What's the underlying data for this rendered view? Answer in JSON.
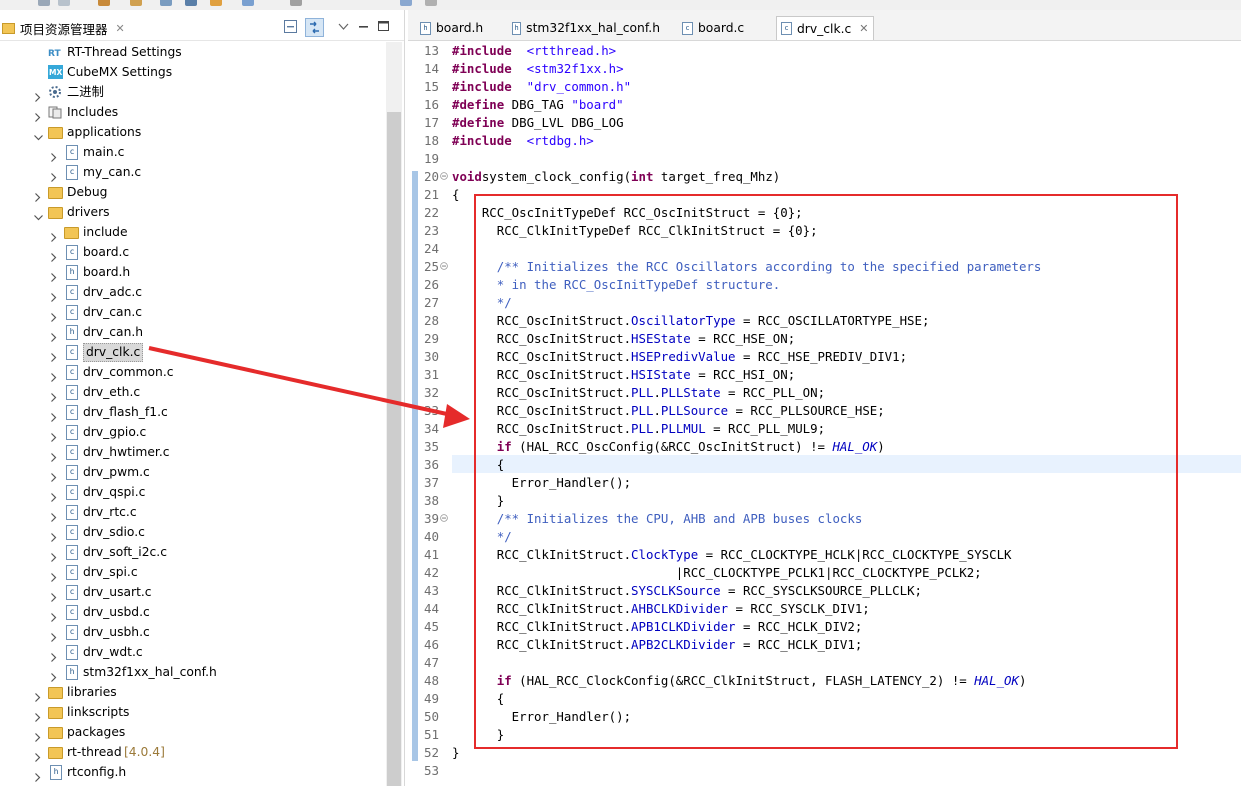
{
  "explorer": {
    "title": "项目资源管理器",
    "close": "✕",
    "items": [
      {
        "label": "RT-Thread Settings",
        "icon": "rt-thread-settings-icon",
        "depth": 1,
        "twisty": "",
        "kind": "special"
      },
      {
        "label": "CubeMX Settings",
        "icon": "cubemx-icon",
        "depth": 1,
        "twisty": "",
        "kind": "special"
      },
      {
        "label": "二进制",
        "icon": "binaries-icon",
        "depth": 1,
        "twisty": ">",
        "kind": "special"
      },
      {
        "label": "Includes",
        "icon": "includes-icon",
        "depth": 1,
        "twisty": ">",
        "kind": "special"
      },
      {
        "label": "applications",
        "icon": "folder-icon",
        "depth": 1,
        "twisty": "v",
        "kind": "folder"
      },
      {
        "label": "main.c",
        "icon": "c-file-icon",
        "depth": 2,
        "twisty": ">",
        "kind": "c"
      },
      {
        "label": "my_can.c",
        "icon": "c-file-icon",
        "depth": 2,
        "twisty": ">",
        "kind": "c"
      },
      {
        "label": "Debug",
        "icon": "folder-icon",
        "depth": 1,
        "twisty": ">",
        "kind": "folder"
      },
      {
        "label": "drivers",
        "icon": "folder-icon",
        "depth": 1,
        "twisty": "v",
        "kind": "folder"
      },
      {
        "label": "include",
        "icon": "folder-icon",
        "depth": 2,
        "twisty": ">",
        "kind": "folder"
      },
      {
        "label": "board.c",
        "icon": "c-file-icon",
        "depth": 2,
        "twisty": ">",
        "kind": "c"
      },
      {
        "label": "board.h",
        "icon": "h-file-icon",
        "depth": 2,
        "twisty": ">",
        "kind": "h"
      },
      {
        "label": "drv_adc.c",
        "icon": "c-file-icon",
        "depth": 2,
        "twisty": ">",
        "kind": "c"
      },
      {
        "label": "drv_can.c",
        "icon": "c-file-icon",
        "depth": 2,
        "twisty": ">",
        "kind": "c"
      },
      {
        "label": "drv_can.h",
        "icon": "h-file-icon",
        "depth": 2,
        "twisty": ">",
        "kind": "h"
      },
      {
        "label": "drv_clk.c",
        "icon": "c-file-icon",
        "depth": 2,
        "twisty": ">",
        "kind": "c",
        "selected": true
      },
      {
        "label": "drv_common.c",
        "icon": "c-file-icon",
        "depth": 2,
        "twisty": ">",
        "kind": "c"
      },
      {
        "label": "drv_eth.c",
        "icon": "c-file-icon",
        "depth": 2,
        "twisty": ">",
        "kind": "c"
      },
      {
        "label": "drv_flash_f1.c",
        "icon": "c-file-icon",
        "depth": 2,
        "twisty": ">",
        "kind": "c"
      },
      {
        "label": "drv_gpio.c",
        "icon": "c-file-icon",
        "depth": 2,
        "twisty": ">",
        "kind": "c"
      },
      {
        "label": "drv_hwtimer.c",
        "icon": "c-file-icon",
        "depth": 2,
        "twisty": ">",
        "kind": "c"
      },
      {
        "label": "drv_pwm.c",
        "icon": "c-file-icon",
        "depth": 2,
        "twisty": ">",
        "kind": "c"
      },
      {
        "label": "drv_qspi.c",
        "icon": "c-file-icon",
        "depth": 2,
        "twisty": ">",
        "kind": "c"
      },
      {
        "label": "drv_rtc.c",
        "icon": "c-file-icon",
        "depth": 2,
        "twisty": ">",
        "kind": "c"
      },
      {
        "label": "drv_sdio.c",
        "icon": "c-file-icon",
        "depth": 2,
        "twisty": ">",
        "kind": "c"
      },
      {
        "label": "drv_soft_i2c.c",
        "icon": "c-file-icon",
        "depth": 2,
        "twisty": ">",
        "kind": "c"
      },
      {
        "label": "drv_spi.c",
        "icon": "c-file-icon",
        "depth": 2,
        "twisty": ">",
        "kind": "c"
      },
      {
        "label": "drv_usart.c",
        "icon": "c-file-icon",
        "depth": 2,
        "twisty": ">",
        "kind": "c"
      },
      {
        "label": "drv_usbd.c",
        "icon": "c-file-icon",
        "depth": 2,
        "twisty": ">",
        "kind": "c"
      },
      {
        "label": "drv_usbh.c",
        "icon": "c-file-icon",
        "depth": 2,
        "twisty": ">",
        "kind": "c"
      },
      {
        "label": "drv_wdt.c",
        "icon": "c-file-icon",
        "depth": 2,
        "twisty": ">",
        "kind": "c"
      },
      {
        "label": "stm32f1xx_hal_conf.h",
        "icon": "h-file-icon",
        "depth": 2,
        "twisty": ">",
        "kind": "h"
      },
      {
        "label": "libraries",
        "icon": "folder-icon",
        "depth": 1,
        "twisty": ">",
        "kind": "folder"
      },
      {
        "label": "linkscripts",
        "icon": "folder-icon",
        "depth": 1,
        "twisty": ">",
        "kind": "folder"
      },
      {
        "label": "packages",
        "icon": "folder-icon",
        "depth": 1,
        "twisty": ">",
        "kind": "folder"
      },
      {
        "label": "rt-thread",
        "icon": "folder-icon",
        "depth": 1,
        "twisty": ">",
        "kind": "folder",
        "suffix": "[4.0.4]"
      },
      {
        "label": "rtconfig.h",
        "icon": "h-file-icon",
        "depth": 1,
        "twisty": ">",
        "kind": "h"
      }
    ]
  },
  "editor_tabs": [
    {
      "label": "board.h",
      "icon": "h-file-icon",
      "active": false
    },
    {
      "label": "stm32f1xx_hal_conf.h",
      "icon": "h-file-icon",
      "active": false
    },
    {
      "label": "board.c",
      "icon": "c-file-icon",
      "active": false
    },
    {
      "label": "drv_clk.c",
      "icon": "c-file-icon",
      "active": true,
      "close": "✕"
    }
  ],
  "code_lines": [
    {
      "n": "13",
      "tokens": [
        [
          "kw",
          "#include"
        ],
        [
          "",
          "  "
        ],
        [
          "str",
          "<rtthread.h>"
        ]
      ]
    },
    {
      "n": "14",
      "tokens": [
        [
          "kw",
          "#include"
        ],
        [
          "",
          "  "
        ],
        [
          "str",
          "<stm32f1xx.h>"
        ]
      ]
    },
    {
      "n": "15",
      "tokens": [
        [
          "kw",
          "#include"
        ],
        [
          "",
          "  "
        ],
        [
          "str",
          "\"drv_common.h\""
        ]
      ]
    },
    {
      "n": "16",
      "tokens": [
        [
          "kw",
          "#define"
        ],
        [
          "",
          " DBG_TAG "
        ],
        [
          "str",
          "\"board\""
        ]
      ]
    },
    {
      "n": "17",
      "tokens": [
        [
          "kw",
          "#define"
        ],
        [
          "",
          " DBG_LVL DBG_LOG"
        ]
      ]
    },
    {
      "n": "18",
      "tokens": [
        [
          "kw",
          "#include"
        ],
        [
          "",
          "  "
        ],
        [
          "str",
          "<rtdbg.h>"
        ]
      ]
    },
    {
      "n": "19",
      "tokens": []
    },
    {
      "n": "20",
      "fold": true,
      "tokens": [
        [
          "kw",
          "void"
        ],
        [
          "",
          "",
          " "
        ],
        [
          "",
          "system_clock_config("
        ],
        [
          "kw",
          "int"
        ],
        [
          "",
          " target_freq_Mhz)"
        ]
      ]
    },
    {
      "n": "21",
      "tokens": [
        [
          "",
          "{"
        ]
      ]
    },
    {
      "n": "22",
      "tokens": [
        [
          "",
          "    RCC_OscInitTypeDef RCC_OscInitStruct = {0};"
        ]
      ]
    },
    {
      "n": "23",
      "tokens": [
        [
          "",
          "      RCC_ClkInitTypeDef RCC_ClkInitStruct = {0};"
        ]
      ]
    },
    {
      "n": "24",
      "tokens": []
    },
    {
      "n": "25",
      "fold": true,
      "tokens": [
        [
          "cm",
          "      /** Initializes the RCC Oscillators according to the specified parameters"
        ]
      ]
    },
    {
      "n": "26",
      "tokens": [
        [
          "cm",
          "      * in the RCC_OscInitTypeDef structure."
        ]
      ]
    },
    {
      "n": "27",
      "tokens": [
        [
          "cm",
          "      */"
        ]
      ]
    },
    {
      "n": "28",
      "tokens": [
        [
          "",
          "      RCC_OscInitStruct."
        ],
        [
          "fld",
          "OscillatorType"
        ],
        [
          "",
          " = RCC_OSCILLATORTYPE_HSE;"
        ]
      ]
    },
    {
      "n": "29",
      "tokens": [
        [
          "",
          "      RCC_OscInitStruct."
        ],
        [
          "fld",
          "HSEState"
        ],
        [
          "",
          " = RCC_HSE_ON;"
        ]
      ]
    },
    {
      "n": "30",
      "tokens": [
        [
          "",
          "      RCC_OscInitStruct."
        ],
        [
          "fld",
          "HSEPredivValue"
        ],
        [
          "",
          " = RCC_HSE_PREDIV_DIV1;"
        ]
      ]
    },
    {
      "n": "31",
      "tokens": [
        [
          "",
          "      RCC_OscInitStruct."
        ],
        [
          "fld",
          "HSIState"
        ],
        [
          "",
          " = RCC_HSI_ON;"
        ]
      ]
    },
    {
      "n": "32",
      "tokens": [
        [
          "",
          "      RCC_OscInitStruct."
        ],
        [
          "fld",
          "PLL"
        ],
        [
          "",
          "."
        ],
        [
          "fld",
          "PLLState"
        ],
        [
          "",
          " = RCC_PLL_ON;"
        ]
      ]
    },
    {
      "n": "33",
      "tokens": [
        [
          "",
          "      RCC_OscInitStruct."
        ],
        [
          "fld",
          "PLL"
        ],
        [
          "",
          "."
        ],
        [
          "fld",
          "PLLSource"
        ],
        [
          "",
          " = RCC_PLLSOURCE_HSE;"
        ]
      ]
    },
    {
      "n": "34",
      "tokens": [
        [
          "",
          "      RCC_OscInitStruct."
        ],
        [
          "fld",
          "PLL"
        ],
        [
          "",
          "."
        ],
        [
          "fld",
          "PLLMUL"
        ],
        [
          "",
          " = RCC_PLL_MUL9;"
        ]
      ]
    },
    {
      "n": "35",
      "tokens": [
        [
          "kw",
          "      if"
        ],
        [
          "",
          " (HAL_RCC_OscConfig(&RCC_OscInitStruct) != "
        ],
        [
          "it",
          "HAL_OK"
        ],
        [
          "",
          ")"
        ]
      ]
    },
    {
      "n": "36",
      "tokens": [
        [
          "",
          "      {"
        ]
      ]
    },
    {
      "n": "37",
      "tokens": [
        [
          "",
          "        Error_Handler();"
        ]
      ]
    },
    {
      "n": "38",
      "tokens": [
        [
          "",
          "      }"
        ]
      ]
    },
    {
      "n": "39",
      "fold": true,
      "tokens": [
        [
          "cm",
          "      /** Initializes the CPU, AHB and APB buses clocks"
        ]
      ]
    },
    {
      "n": "40",
      "tokens": [
        [
          "cm",
          "      */"
        ]
      ]
    },
    {
      "n": "41",
      "tokens": [
        [
          "",
          "      RCC_ClkInitStruct."
        ],
        [
          "fld",
          "ClockType"
        ],
        [
          "",
          " = RCC_CLOCKTYPE_HCLK|RCC_CLOCKTYPE_SYSCLK"
        ]
      ]
    },
    {
      "n": "42",
      "tokens": [
        [
          "",
          "                              |RCC_CLOCKTYPE_PCLK1|RCC_CLOCKTYPE_PCLK2;"
        ]
      ]
    },
    {
      "n": "43",
      "tokens": [
        [
          "",
          "      RCC_ClkInitStruct."
        ],
        [
          "fld",
          "SYSCLKSource"
        ],
        [
          "",
          " = RCC_SYSCLKSOURCE_PLLCLK;"
        ]
      ]
    },
    {
      "n": "44",
      "tokens": [
        [
          "",
          "      RCC_ClkInitStruct."
        ],
        [
          "fld",
          "AHBCLKDivider"
        ],
        [
          "",
          " = RCC_SYSCLK_DIV1;"
        ]
      ]
    },
    {
      "n": "45",
      "tokens": [
        [
          "",
          "      RCC_ClkInitStruct."
        ],
        [
          "fld",
          "APB1CLKDivider"
        ],
        [
          "",
          " = RCC_HCLK_DIV2;"
        ]
      ]
    },
    {
      "n": "46",
      "tokens": [
        [
          "",
          "      RCC_ClkInitStruct."
        ],
        [
          "fld",
          "APB2CLKDivider"
        ],
        [
          "",
          " = RCC_HCLK_DIV1;"
        ]
      ]
    },
    {
      "n": "47",
      "tokens": []
    },
    {
      "n": "48",
      "tokens": [
        [
          "kw",
          "      if"
        ],
        [
          "",
          " (HAL_RCC_ClockConfig(&RCC_ClkInitStruct, FLASH_LATENCY_2) != "
        ],
        [
          "it",
          "HAL_OK"
        ],
        [
          "",
          ")"
        ]
      ]
    },
    {
      "n": "49",
      "tokens": [
        [
          "",
          "      {"
        ]
      ]
    },
    {
      "n": "50",
      "tokens": [
        [
          "",
          "        Error_Handler();"
        ]
      ]
    },
    {
      "n": "51",
      "tokens": [
        [
          "",
          "      }"
        ]
      ]
    },
    {
      "n": "52",
      "tokens": [
        [
          "",
          "}"
        ]
      ]
    },
    {
      "n": "53",
      "tokens": []
    }
  ],
  "colors": {
    "highlight_box": "#e52b2b",
    "arrow": "#e52b2b",
    "keyword": "#7f0055",
    "string": "#2a00ff",
    "comment": "#3f5fbf",
    "field": "#0000c0",
    "selection": "#d9d9d9"
  }
}
